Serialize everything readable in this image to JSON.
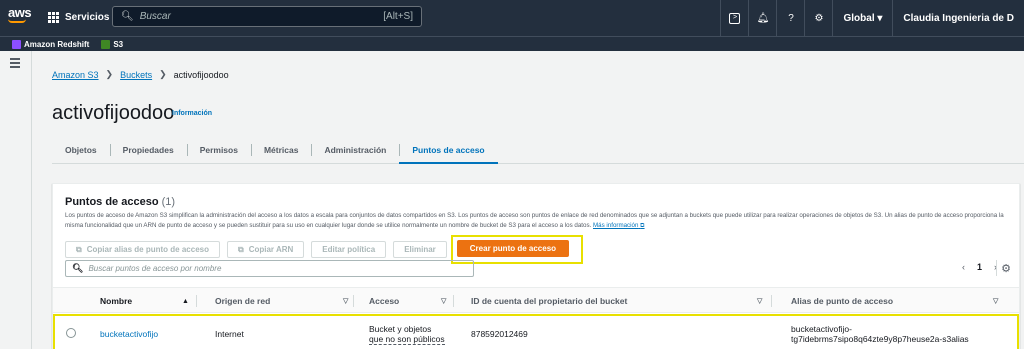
{
  "topnav": {
    "logo": "aws",
    "services_label": "Servicios",
    "search_placeholder": "Buscar",
    "search_shortcut": "[Alt+S]",
    "region_label": "Global ▾",
    "account_label": "Claudia Ingenieria de D",
    "icons": [
      "cloudshell-icon",
      "bell-icon",
      "help-icon",
      "settings-icon"
    ]
  },
  "favorites": [
    {
      "label": "Amazon Redshift",
      "color": "#8c4fff"
    },
    {
      "label": "S3",
      "color": "#3f8624"
    }
  ],
  "breadcrumb": {
    "items": [
      "Amazon S3",
      "Buckets"
    ],
    "current": "activofijoodoo"
  },
  "page": {
    "title": "activofijoodoo",
    "info": "Información"
  },
  "tabs": [
    {
      "label": "Objetos",
      "active": false
    },
    {
      "label": "Propiedades",
      "active": false
    },
    {
      "label": "Permisos",
      "active": false
    },
    {
      "label": "Métricas",
      "active": false
    },
    {
      "label": "Administración",
      "active": false
    },
    {
      "label": "Puntos de acceso",
      "active": true
    }
  ],
  "panel": {
    "title": "Puntos de acceso",
    "count": "(1)",
    "description": "Los puntos de acceso de Amazon S3 simplifican la administración del acceso a los datos a escala para conjuntos de datos compartidos en S3. Los puntos de acceso son puntos de enlace de red denominados que se adjuntan a buckets que puede utilizar para realizar operaciones de objetos de S3. Un alias de punto de acceso proporciona la misma funcionalidad que un ARN de punto de acceso y se pueden sustituir para su uso en cualquier lugar donde se utilice normalmente un nombre de bucket de S3 para el acceso a los datos.",
    "more_info": "Más información",
    "buttons": {
      "copy_alias": "Copiar alias de punto de acceso",
      "copy_arn": "Copiar ARN",
      "edit_policy": "Editar política",
      "delete": "Eliminar",
      "create": "Crear punto de acceso"
    },
    "filter_placeholder": "Buscar puntos de acceso por nombre",
    "pagination": {
      "prev": "‹",
      "page": "1",
      "next": "›"
    }
  },
  "table": {
    "columns": [
      "Nombre",
      "Origen de red",
      "Acceso",
      "ID de cuenta del propietario del bucket",
      "Alias de punto de acceso"
    ],
    "rows": [
      {
        "name": "bucketactivofijo",
        "network_origin": "Internet",
        "access_line1": "Bucket y objetos",
        "access_line2": "que no son públicos",
        "account_id": "878592012469",
        "alias_line1": "bucketactivofijo-",
        "alias_line2": "tg7idebrms7sipo8q64zte9y8p7heuse2a-s3alias"
      }
    ]
  },
  "colors": {
    "nav_bg": "#232f3e",
    "link": "#0073bb",
    "primary": "#ec7211",
    "highlight": "#e8e000"
  }
}
